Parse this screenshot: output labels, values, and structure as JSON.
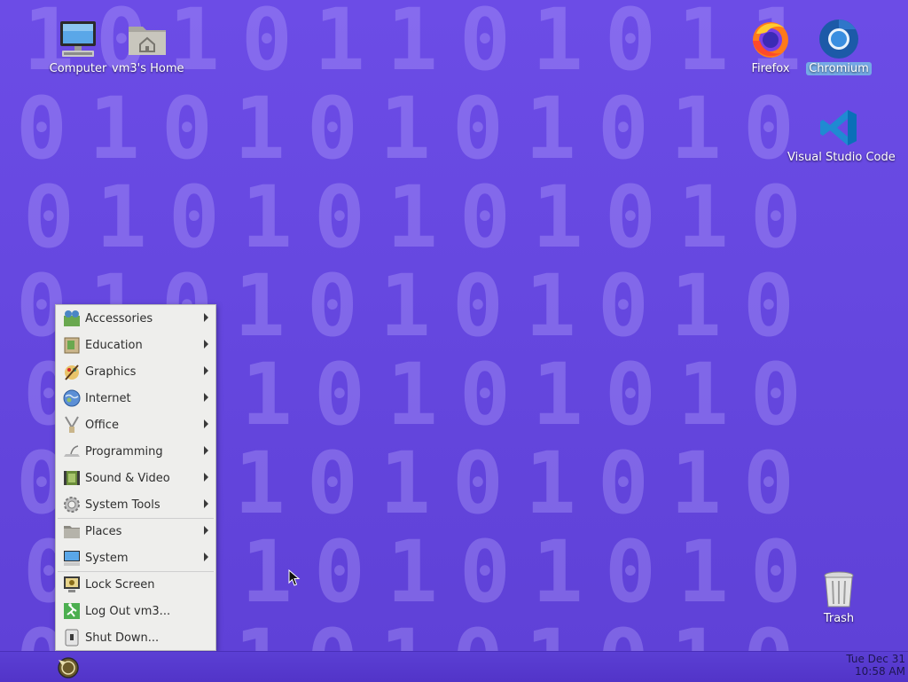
{
  "desktop": {
    "icons": {
      "computer": "Computer",
      "home": "vm3's Home",
      "firefox": "Firefox",
      "chromium": "Chromium",
      "vscode": "Visual Studio Code",
      "trash": "Trash"
    },
    "wallpaper_rows": [
      "10101101011",
      "01010101010",
      "01010101010",
      "01010101010",
      "01010101010",
      "01010101010",
      "01010101010",
      "01010101010"
    ]
  },
  "menu": {
    "items": [
      {
        "label": "Accessories",
        "icon": "accessories-icon"
      },
      {
        "label": "Education",
        "icon": "education-icon"
      },
      {
        "label": "Graphics",
        "icon": "graphics-icon"
      },
      {
        "label": "Internet",
        "icon": "internet-icon"
      },
      {
        "label": "Office",
        "icon": "office-icon"
      },
      {
        "label": "Programming",
        "icon": "programming-icon"
      },
      {
        "label": "Sound & Video",
        "icon": "sound-video-icon"
      },
      {
        "label": "System Tools",
        "icon": "system-tools-icon"
      },
      {
        "label": "Places",
        "icon": "folder-icon"
      },
      {
        "label": "System",
        "icon": "system-icon"
      },
      {
        "label": "Lock Screen",
        "icon": "lock-screen-icon"
      },
      {
        "label": "Log Out vm3...",
        "icon": "log-out-icon"
      },
      {
        "label": "Shut Down...",
        "icon": "shutdown-icon"
      }
    ]
  },
  "panel": {
    "clock_date": "Tue Dec 31",
    "clock_time": "10:58 AM"
  },
  "colors": {
    "wallpaper": "#6a4ae0",
    "menu_bg": "#eeeeec",
    "panel_bg": "#5639cc"
  }
}
